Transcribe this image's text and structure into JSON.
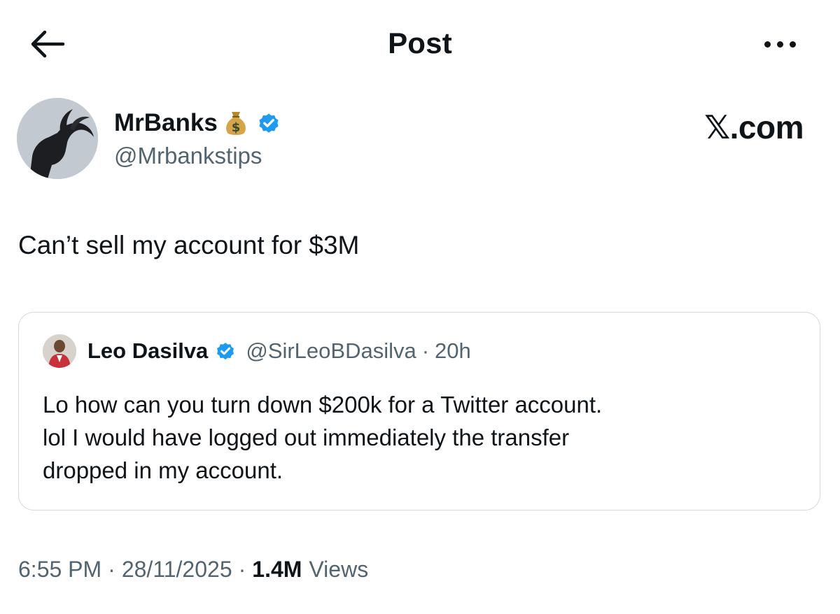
{
  "header": {
    "back_icon": "arrow-left-icon",
    "title": "Post",
    "more_icon": "more-horizontal-icon"
  },
  "author": {
    "name": "MrBanks",
    "name_emoji": "money-bag-icon",
    "verified_icon": "verified-badge-icon",
    "handle": "@Mrbankstips"
  },
  "watermark": "𝕏.com",
  "post": {
    "text": "Can’t sell my account for $3M"
  },
  "quoted_post": {
    "name": "Leo Dasilva",
    "verified_icon": "verified-badge-icon",
    "handle": "@SirLeoBDasilva",
    "separator": "·",
    "time": "20h",
    "lines": [
      "Lo how can you turn down $200k for a Twitter account.",
      "lol I would have logged out immediately the transfer",
      "dropped in my account."
    ]
  },
  "meta": {
    "time": "6:55 PM",
    "separator": "·",
    "date": "28/11/2025",
    "views_count": "1.4M",
    "views_label": "Views"
  },
  "colors": {
    "text_primary": "#0f1419",
    "text_secondary": "#536471",
    "verified_blue": "#1d9bf0",
    "card_border": "#cfd9de"
  }
}
